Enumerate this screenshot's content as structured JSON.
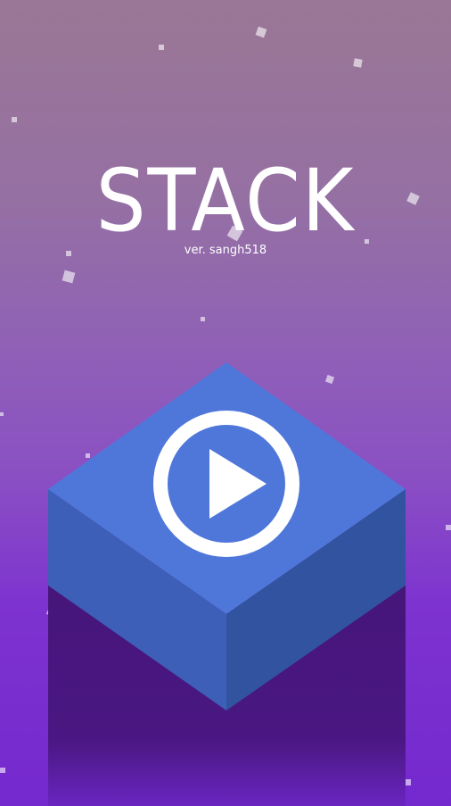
{
  "title": "STACK",
  "version": "ver. sangh518",
  "play_button": {
    "icon": "play-icon"
  },
  "colors": {
    "block_top": "#4f77da",
    "block_left": "#3e5fb8",
    "block_right": "#3253a0",
    "shadow": "#46167a",
    "accent": "#ffffff"
  }
}
